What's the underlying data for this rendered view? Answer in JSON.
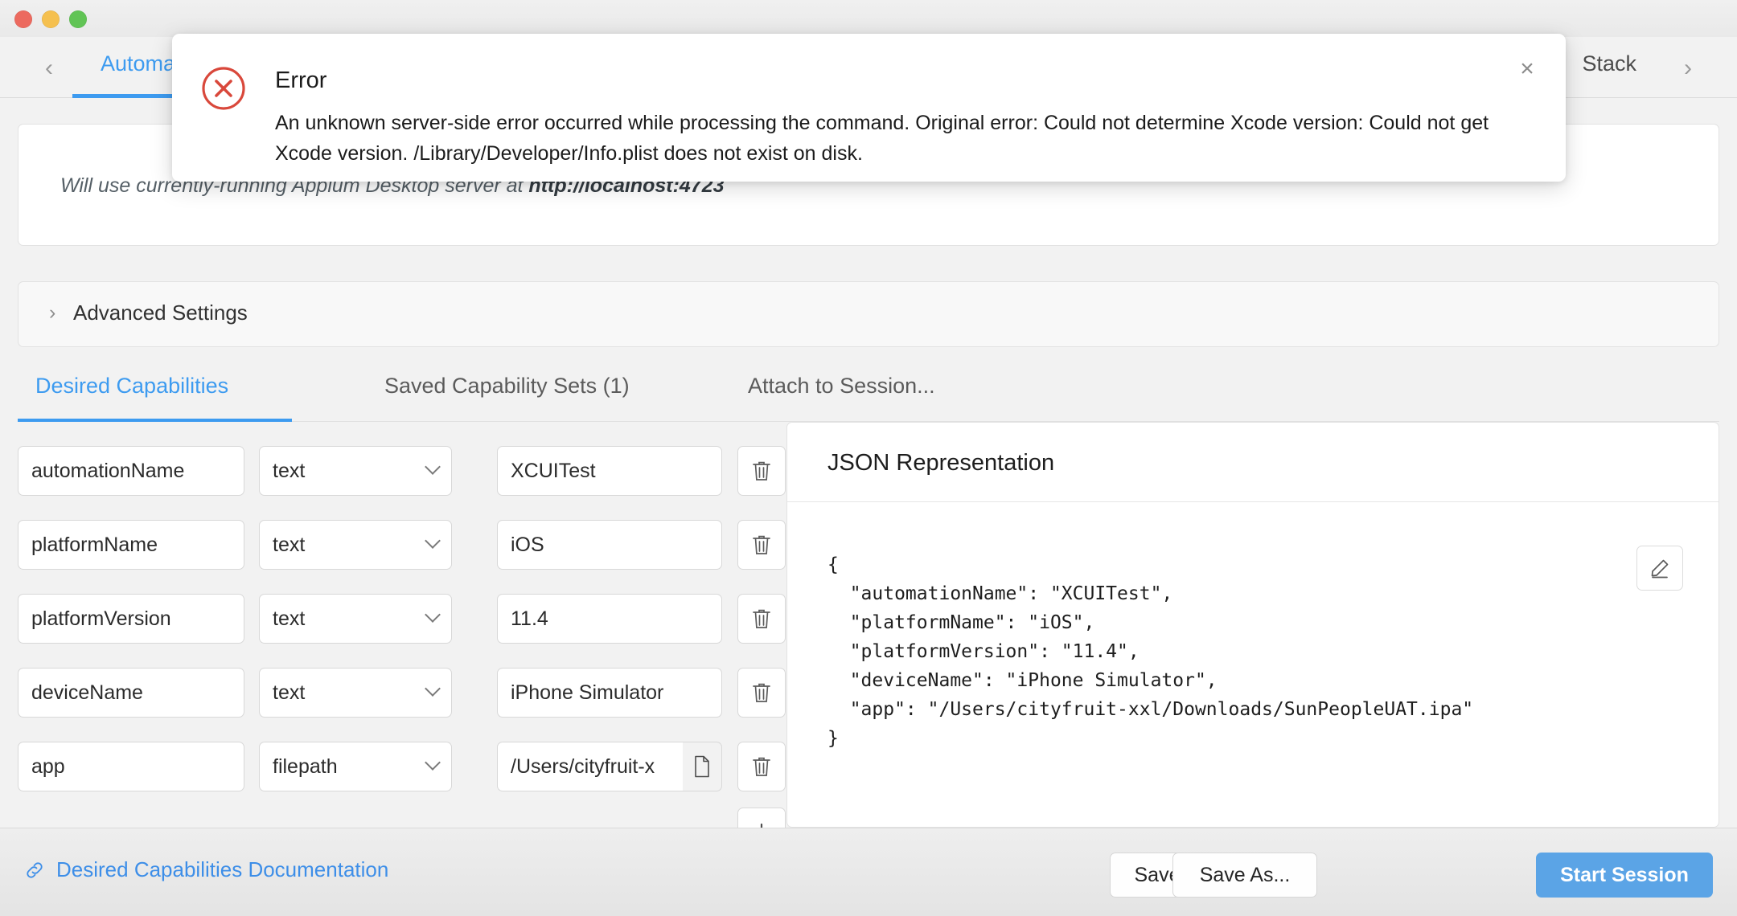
{
  "window": {
    "traffic_lights": [
      "close",
      "minimize",
      "zoom"
    ]
  },
  "topbar": {
    "prev_arrow": "‹",
    "next_arrow": "›",
    "active_tab": "Automatic Server",
    "right_tab": "Stack"
  },
  "server_card": {
    "message_prefix": "Will use currently-running Appium Desktop server at ",
    "message_server": "http://localhost:4723"
  },
  "advanced": {
    "chevron": "›",
    "label": "Advanced Settings"
  },
  "subtabs": [
    {
      "label": "Desired Capabilities",
      "active": true
    },
    {
      "label": "Saved Capability Sets (1)",
      "active": false
    },
    {
      "label": "Attach to Session...",
      "active": false
    }
  ],
  "capabilities": {
    "rows": [
      {
        "name": "automationName",
        "type": "text",
        "value": "XCUITest",
        "has_file_picker": false
      },
      {
        "name": "platformName",
        "type": "text",
        "value": "iOS",
        "has_file_picker": false
      },
      {
        "name": "platformVersion",
        "type": "text",
        "value": "11.4",
        "has_file_picker": false
      },
      {
        "name": "deviceName",
        "type": "text",
        "value": "iPhone Simulator",
        "has_file_picker": false
      },
      {
        "name": "app",
        "type": "filepath",
        "value": "/Users/cityfruit-x",
        "has_file_picker": true
      }
    ],
    "add_label": "+"
  },
  "json_panel": {
    "title": "JSON Representation",
    "content": "{\n  \"automationName\": \"XCUITest\",\n  \"platformName\": \"iOS\",\n  \"platformVersion\": \"11.4\",\n  \"deviceName\": \"iPhone Simulator\",\n  \"app\": \"/Users/cityfruit-xxl/Downloads/SunPeopleUAT.ipa\"\n}"
  },
  "footer": {
    "doc_link": "Desired Capabilities Documentation",
    "save": "Save",
    "save_as": "Save As...",
    "start_session": "Start Session"
  },
  "dialog": {
    "title": "Error",
    "message": "An unknown server-side error occurred while processing the command. Original error: Could not determine Xcode version: Could not get Xcode version. /Library/Developer/Info.plist does not exist on disk.",
    "close": "×"
  },
  "colors": {
    "accent": "#3d9bf0",
    "primary_button": "#5ba4e6",
    "error": "#d9483b",
    "link": "#3d8ee8"
  }
}
